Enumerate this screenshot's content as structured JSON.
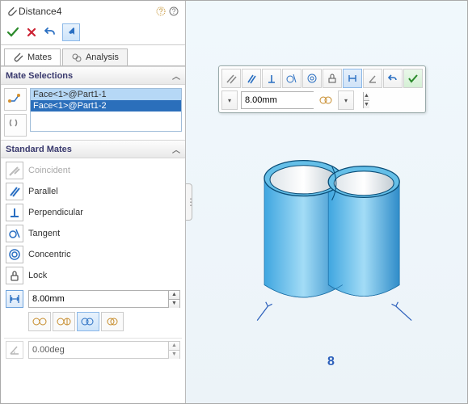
{
  "header": {
    "title": "Distance4"
  },
  "tabs": {
    "mates_label": "Mates",
    "analysis_label": "Analysis"
  },
  "sections": {
    "mate_selections": "Mate Selections",
    "standard_mates": "Standard Mates"
  },
  "selections": {
    "items": [
      "Face<1>@Part1-1",
      "Face<1>@Part1-2"
    ]
  },
  "mates": {
    "coincident": "Coincident",
    "parallel": "Parallel",
    "perpendicular": "Perpendicular",
    "tangent": "Tangent",
    "concentric": "Concentric",
    "lock": "Lock"
  },
  "distance": {
    "value": "8.00mm"
  },
  "angle": {
    "value": "0.00deg"
  },
  "context_toolbar": {
    "distance_value": "8.00mm"
  },
  "viewport": {
    "dimension_label": "8"
  }
}
